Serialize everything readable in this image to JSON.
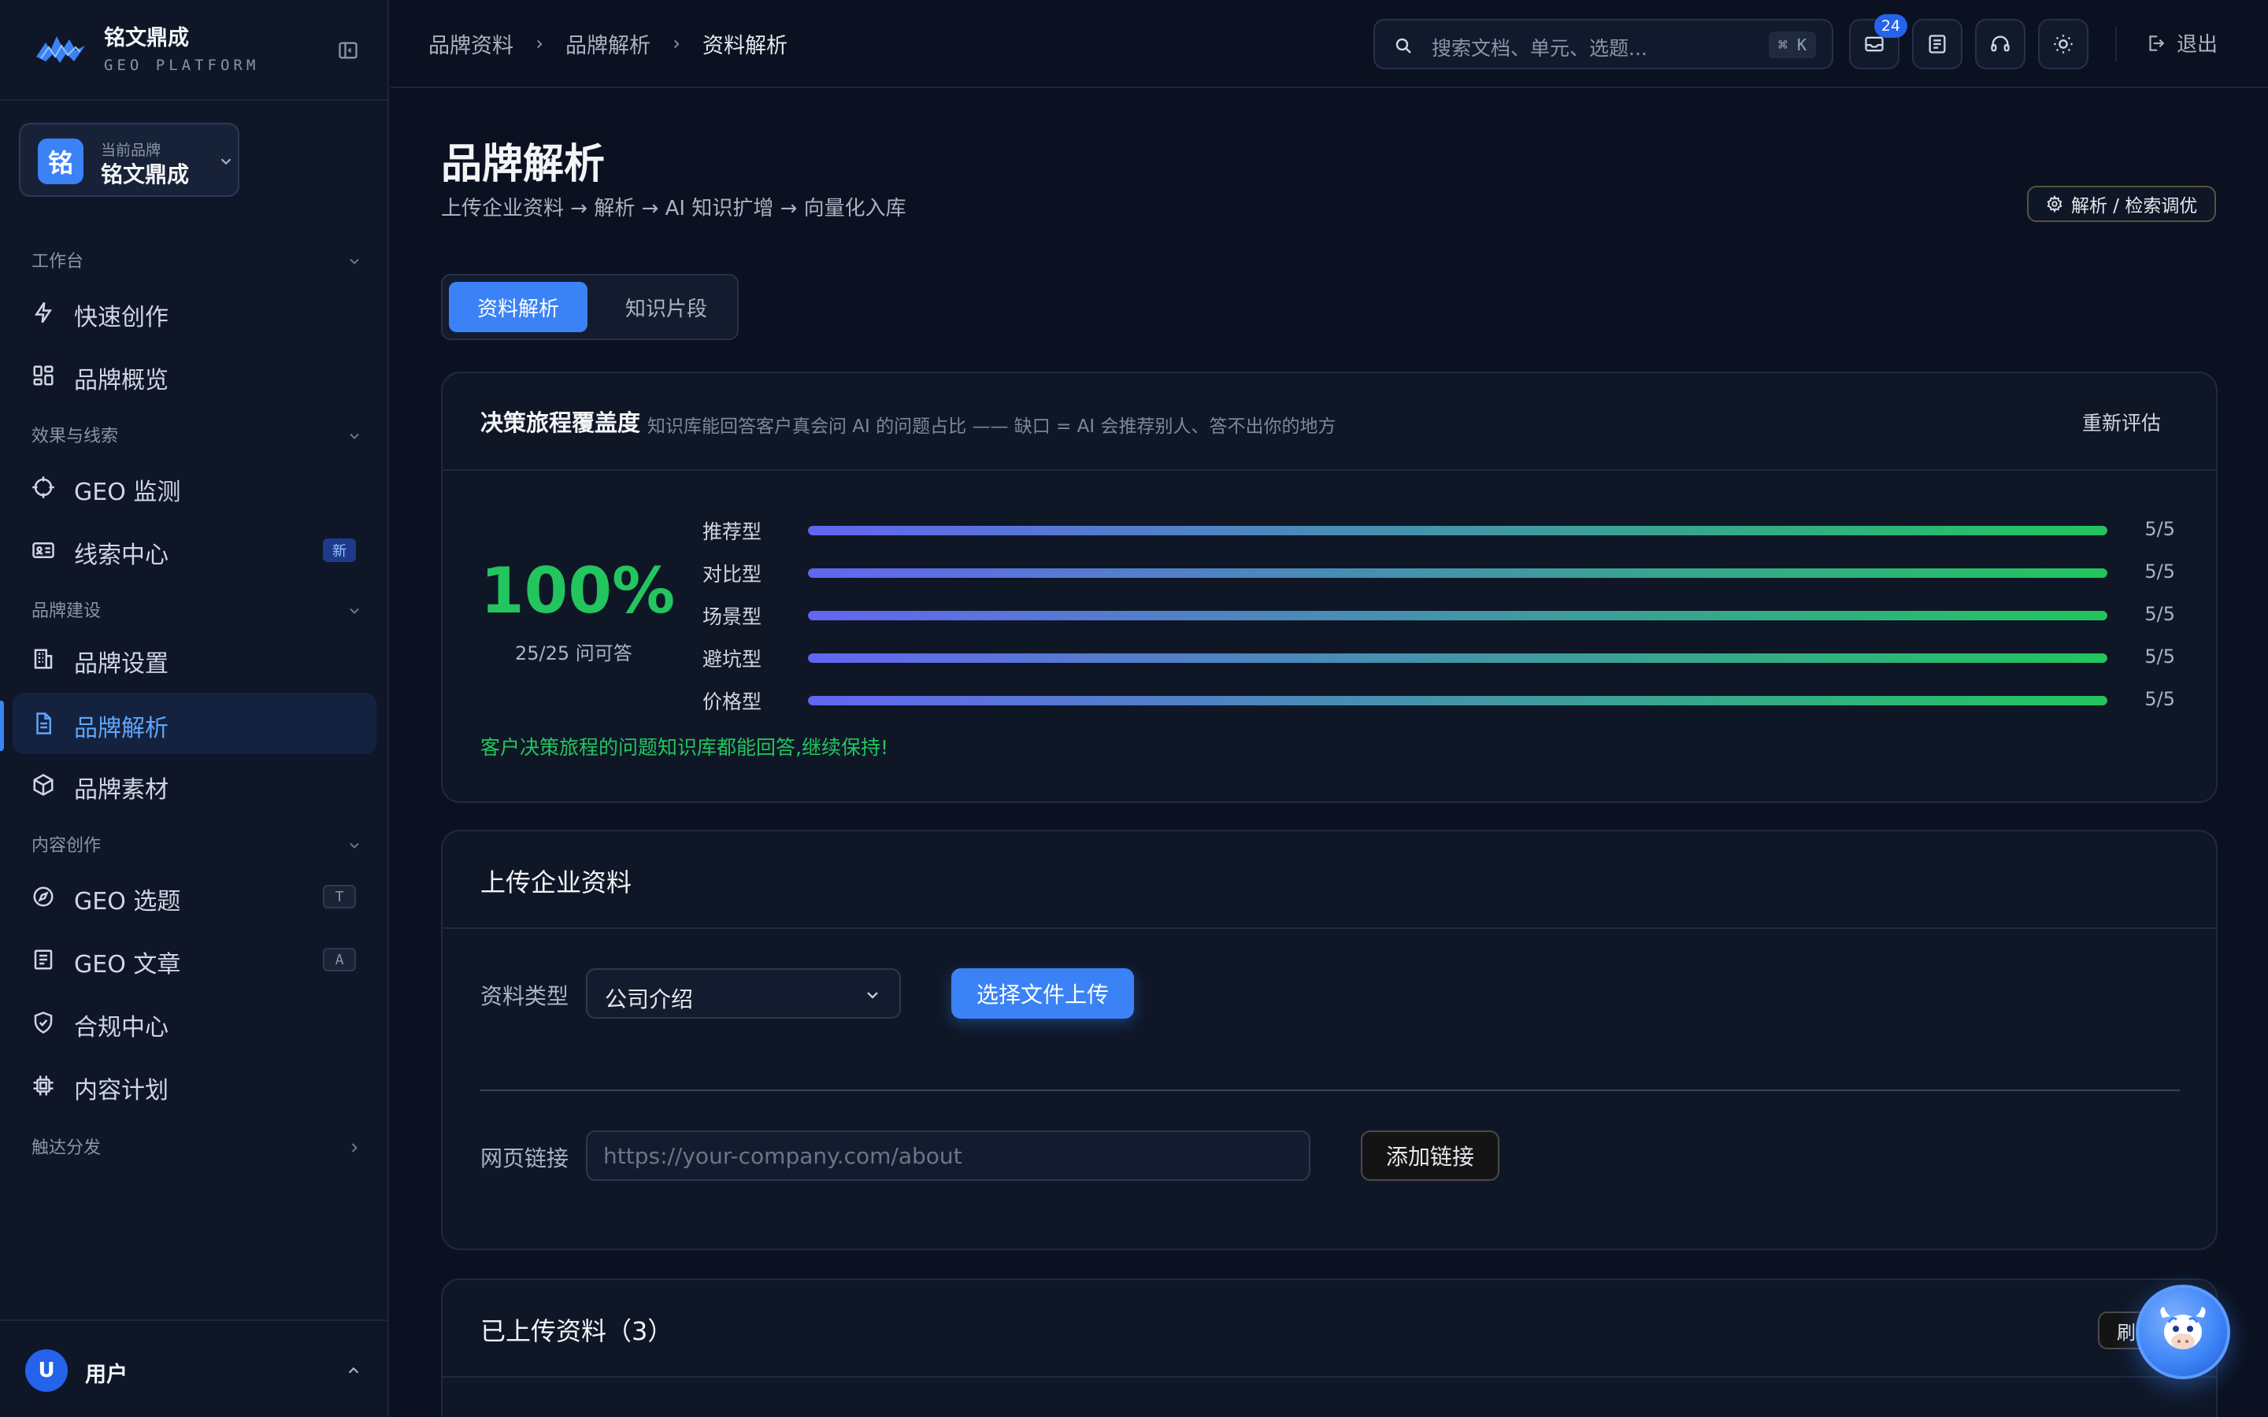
{
  "logo": {
    "name": "铭文鼎成",
    "subtitle": "GEO PLATFORM"
  },
  "brand_switcher": {
    "label": "当前品牌",
    "name": "铭文鼎成",
    "avatar_char": "铭"
  },
  "sidebar": {
    "sections": [
      {
        "label": "工作台",
        "chevron": "chevron-down-icon"
      },
      {
        "label": "效果与线索",
        "chevron": "chevron-down-icon"
      },
      {
        "label": "品牌建设",
        "chevron": "chevron-down-icon"
      },
      {
        "label": "内容创作",
        "chevron": "chevron-down-icon"
      },
      {
        "label": "触达分发",
        "chevron": "chevron-right-icon"
      }
    ],
    "items": [
      {
        "label": "快速创作",
        "icon": "lightning-icon"
      },
      {
        "label": "品牌概览",
        "icon": "grid-icon"
      },
      {
        "label": "GEO 监测",
        "icon": "crosshair-icon"
      },
      {
        "label": "线索中心",
        "icon": "id-card-icon",
        "badge": "新"
      },
      {
        "label": "品牌设置",
        "icon": "building-icon"
      },
      {
        "label": "品牌解析",
        "icon": "document-icon",
        "active": true
      },
      {
        "label": "品牌素材",
        "icon": "cube-icon"
      },
      {
        "label": "GEO 选题",
        "icon": "compass-icon",
        "badge": "T"
      },
      {
        "label": "GEO 文章",
        "icon": "article-icon",
        "badge": "A"
      },
      {
        "label": "合规中心",
        "icon": "shield-check-icon"
      },
      {
        "label": "内容计划",
        "icon": "chip-icon"
      }
    ]
  },
  "user": {
    "name": "用户",
    "avatar_char": "U"
  },
  "topbar": {
    "breadcrumbs": [
      "品牌资料",
      "品牌解析",
      "资料解析"
    ],
    "search": {
      "placeholder": "搜索文档、单元、选题...",
      "shortcut": "⌘ K"
    },
    "notification_count": "24",
    "logout_label": "退出"
  },
  "page": {
    "title": "品牌解析",
    "subtitle": "上传企业资料 → 解析 → AI 知识扩增 → 向量化入库",
    "tune_button": "解析 / 检索调优",
    "tabs": [
      {
        "label": "资料解析",
        "active": true
      },
      {
        "label": "知识片段",
        "active": false
      }
    ]
  },
  "coverage": {
    "title": "决策旅程覆盖度",
    "description": "知识库能回答客户真会问 AI 的问题占比 —— 缺口 = AI 会推荐别人、答不出你的地方",
    "reevaluate_label": "重新评估",
    "percent": "100%",
    "answered": "25/25 问可答",
    "rows": [
      {
        "label": "推荐型",
        "score": "5/5",
        "fraction": 1.0
      },
      {
        "label": "对比型",
        "score": "5/5",
        "fraction": 1.0
      },
      {
        "label": "场景型",
        "score": "5/5",
        "fraction": 1.0
      },
      {
        "label": "避坑型",
        "score": "5/5",
        "fraction": 1.0
      },
      {
        "label": "价格型",
        "score": "5/5",
        "fraction": 1.0
      }
    ],
    "note": "客户决策旅程的问题知识库都能回答,继续保持!",
    "gradient": [
      "#6366f1",
      "#22c55e"
    ]
  },
  "upload": {
    "title": "上传企业资料",
    "type_label": "资料类型",
    "type_value": "公司介绍",
    "upload_button": "选择文件上传",
    "url_label": "网页链接",
    "url_placeholder": "https://your-company.com/about",
    "add_link_button": "添加链接"
  },
  "uploaded": {
    "title": "已上传资料（3）",
    "refresh_label": "刷新"
  },
  "colors": {
    "accent": "#3b82f6",
    "success": "#22c55e",
    "background": "#0b1120"
  }
}
